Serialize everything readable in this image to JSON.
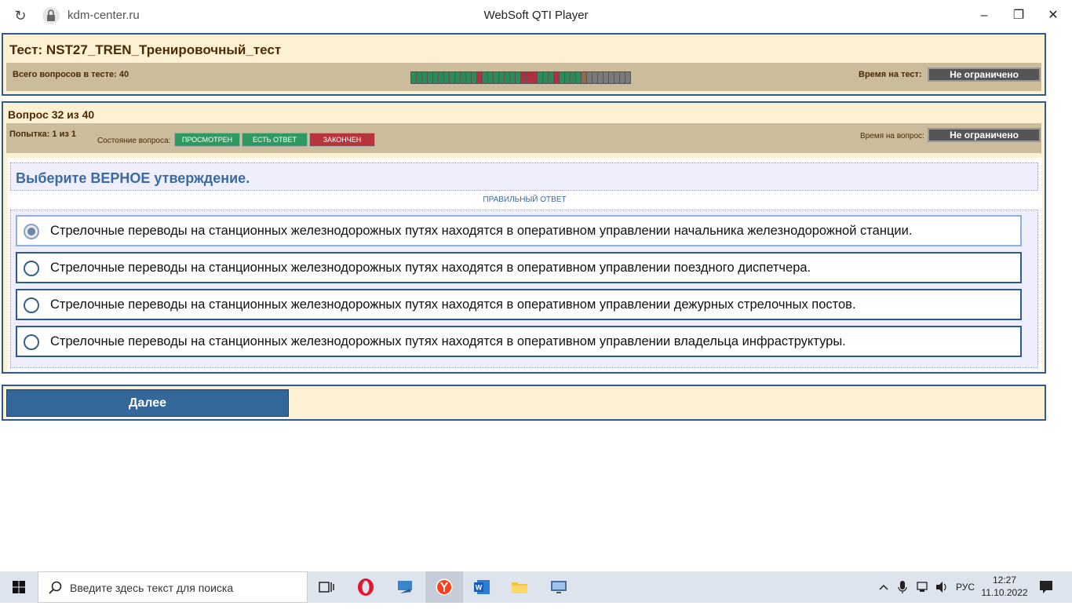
{
  "browser": {
    "url": "kdm-center.ru",
    "window_title": "WebSoft QTI Player"
  },
  "test_header": {
    "title": "Тест: NST27_TREN_Тренировочный_тест",
    "total_label": "Всего вопросов в тесте: 40",
    "time_label": "Время на тест:",
    "time_value": "Не ограничено",
    "progress": [
      "answered",
      "answered",
      "answered",
      "answered",
      "answered",
      "answered",
      "answered",
      "answered",
      "answered",
      "answered",
      "answered",
      "answered",
      "wrong",
      "answered",
      "answered",
      "answered",
      "answered",
      "answered",
      "answered",
      "answered",
      "wrong",
      "wrong",
      "wrong",
      "answered",
      "answered",
      "answered",
      "wrong",
      "answered",
      "answered",
      "answered",
      "answered",
      "current",
      "pending",
      "pending",
      "pending",
      "pending",
      "pending",
      "pending",
      "pending",
      "pending"
    ],
    "colors": {
      "answered": "#2e8b57",
      "wrong": "#b03040",
      "current": "#8e6a4e",
      "pending": "#7a7a7a"
    }
  },
  "question_header": {
    "title": "Вопрос 32 из 40",
    "attempt": "Попытка: 1 из 1",
    "state_label": "Состояние вопроса:",
    "states": [
      {
        "label": "ПРОСМОТРЕН",
        "color": "#2e9a62"
      },
      {
        "label": "ЕСТЬ ОТВЕТ",
        "color": "#2e9a62"
      },
      {
        "label": "ЗАКОНЧЕН",
        "color": "#b8343c"
      }
    ],
    "time_label": "Время на вопрос:",
    "time_value": "Не ограничено"
  },
  "question": {
    "text": "Выберите ВЕРНОЕ утверждение.",
    "correct_label": "ПРАВИЛЬНЫЙ ОТВЕТ",
    "answers": [
      {
        "text": "Стрелочные переводы на станционных железнодорожных путях находятся в оперативном управлении начальника железнодорожной станции.",
        "selected": true
      },
      {
        "text": "Стрелочные переводы на станционных железнодорожных путях находятся в оперативном управлении поездного диспетчера.",
        "selected": false
      },
      {
        "text": "Стрелочные переводы на станционных железнодорожных путях находятся в оперативном управлении дежурных стрелочных постов.",
        "selected": false
      },
      {
        "text": "Стрелочные переводы на станционных железнодорожных путях находятся в оперативном управлении владельца инфраструктуры.",
        "selected": false
      }
    ]
  },
  "footer": {
    "next_label": "Далее"
  },
  "taskbar": {
    "search_placeholder": "Введите здесь текст для поиска",
    "lang": "РУС",
    "time": "12:27",
    "date": "11.10.2022"
  }
}
